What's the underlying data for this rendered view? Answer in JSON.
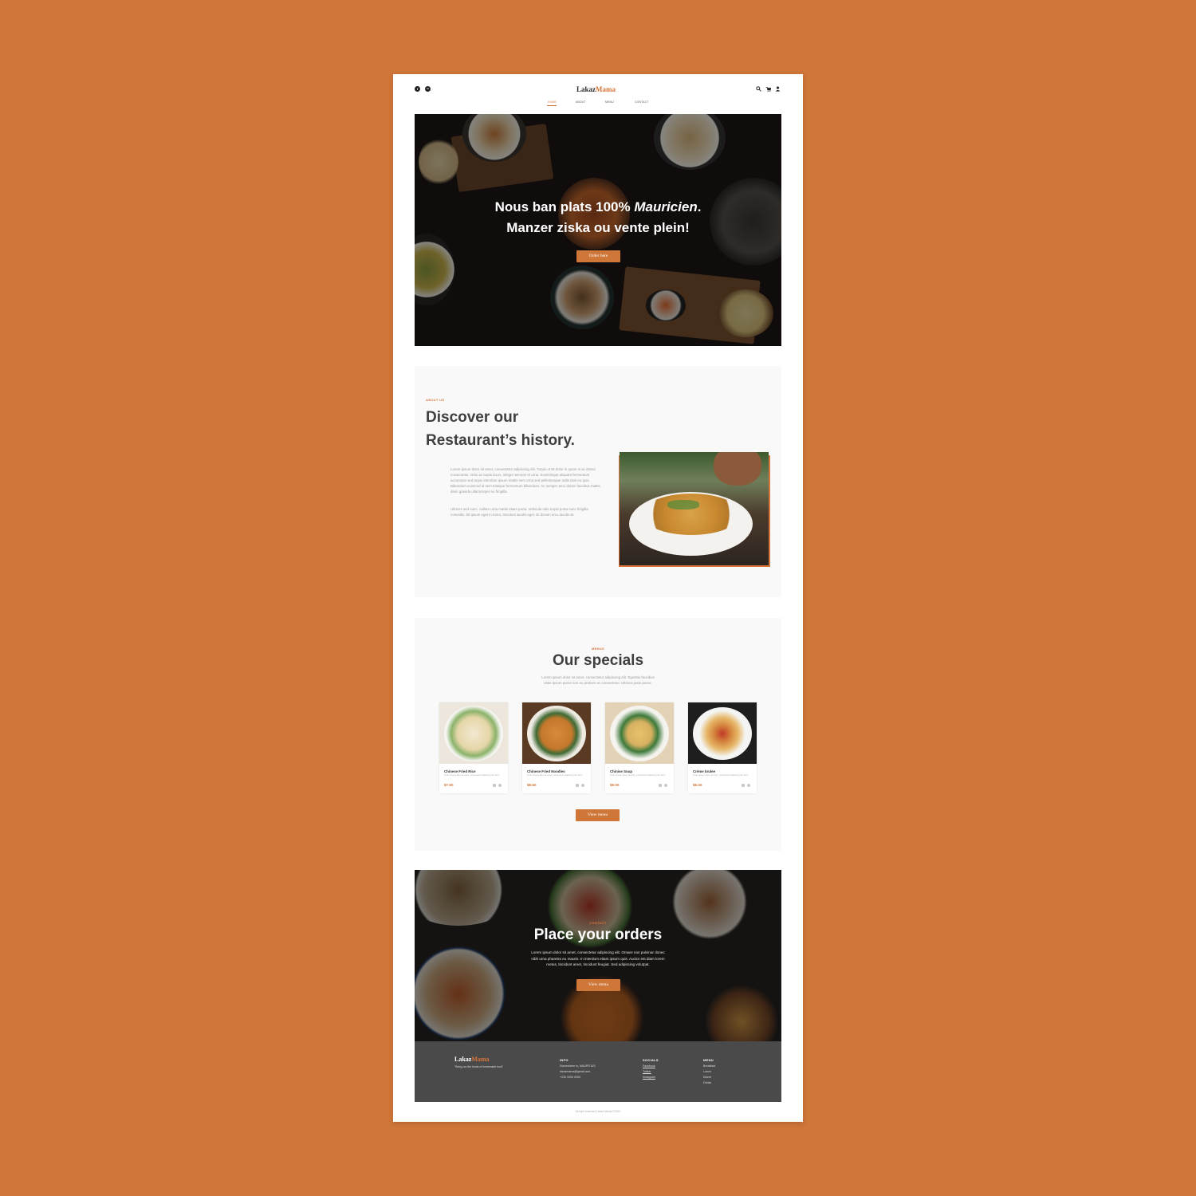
{
  "brand": {
    "logo_part1": "Lakaz",
    "logo_part2": "Mama",
    "accent_color": "#D8753A",
    "background_color": "#CF7639"
  },
  "header": {
    "socials": [
      {
        "icon": "facebook-icon",
        "glyph": "f"
      },
      {
        "icon": "linkedin-icon",
        "glyph": "in"
      }
    ],
    "nav": [
      {
        "label": "HOME",
        "active": true
      },
      {
        "label": "ABOUT"
      },
      {
        "label": "MENU"
      },
      {
        "label": "CONTACT"
      }
    ],
    "right_icons": [
      "search-icon",
      "cart-icon",
      "user-icon"
    ]
  },
  "hero": {
    "line1_prefix": "Nous ban plats 100% ",
    "line1_emphasis": "Mauricien",
    "line1_suffix": ".",
    "line2": "Manzer ziska ou vente plein!",
    "button": "Order here"
  },
  "about": {
    "eyebrow": "ABOUT US",
    "title_line1": "Discover our",
    "title_line2": "Restaurant’s history.",
    "paragraph1": "Lorem ipsum dolor sit amet, consectetur adipiscing elit. Turpis ut sit dolor in quam in ac donec consectetur. Odio ac turpis lacus, integer aenean et urna. Scelerisque aliquam fermentum accumsan sed turpis interdum ipsum mattis sem urna sed pellentesque nulla duis eu quis. Bibendum euismod id sem tristique fermentum bibendum. Ac semper arcu donec faucibus mattis diam gravida ullamcorper eu fringilla.",
    "paragraph2": "Ultrices sed nunc, nullam urna mattis etiam porta. Vehicula odio turpis porta nunc fringilla convallis. Sit ipsum eget in tortor, tincidunt iaculis eget. Et dictum arcu iaculis sit."
  },
  "specials": {
    "eyebrow": "MENUS",
    "title": "Our specials",
    "subtitle_line1": "Lorem ipsum dolor sit amet, consectetur adipiscing elit. Egestas faucibus",
    "subtitle_line2": "vitae ipsum purus non eu pretium ac consectetur. Ultrices justo purus.",
    "items": [
      {
        "name": "Chinese Fried Rice",
        "desc": "Lorem ipsum dolor sit amet, consectetur adipiscing elit. Sed.",
        "price": "$7.50"
      },
      {
        "name": "Chinese Fried Noodles",
        "desc": "Lorem ipsum dolor sit amet, consectetur adipiscing elit. Sed.",
        "price": "$8.50"
      },
      {
        "name": "Chinise Soup",
        "desc": "Lorem ipsum dolor sit amet, consectetur adipiscing elit. Sed.",
        "price": "$9.00"
      },
      {
        "name": "Crème brulee",
        "desc": "Lorem ipsum dolor sit amet, consectetur adipiscing elit. Sed.",
        "price": "$5.00"
      }
    ],
    "button": "View menu"
  },
  "contact": {
    "eyebrow": "CONTACT",
    "title": "Place your orders",
    "text_line1": "Lorem ipsum dolor sit amet, consectetur adipiscing elit. Ornare non pulvinar donec",
    "text_line2": "nibh urna pharetra eu mauris. In interdum etiam ipsum quis. Auctor est diam lorem",
    "text_line3": "metus, tincidunt amet, tincidunt feugiat. Sed adipiscing volutpat.",
    "button": "View menu"
  },
  "footer": {
    "tagline": "\"Bring you the foods of homemade food\"",
    "info_heading": "INFO",
    "info_lines": [
      "Somewhere in, MAURITIUS",
      "lakazmama@gmail.com",
      "+230 0000 0000"
    ],
    "socials_heading": "SOCIALS",
    "socials_lines": [
      "Facebook",
      "Twitter",
      "Instagram"
    ],
    "menu_heading": "MENU",
    "menu_lines": [
      "Breakfast",
      "Lunch",
      "Dinner",
      "Drinks"
    ],
    "copyright": "All right reserved Lakaz Mama ©2021"
  }
}
